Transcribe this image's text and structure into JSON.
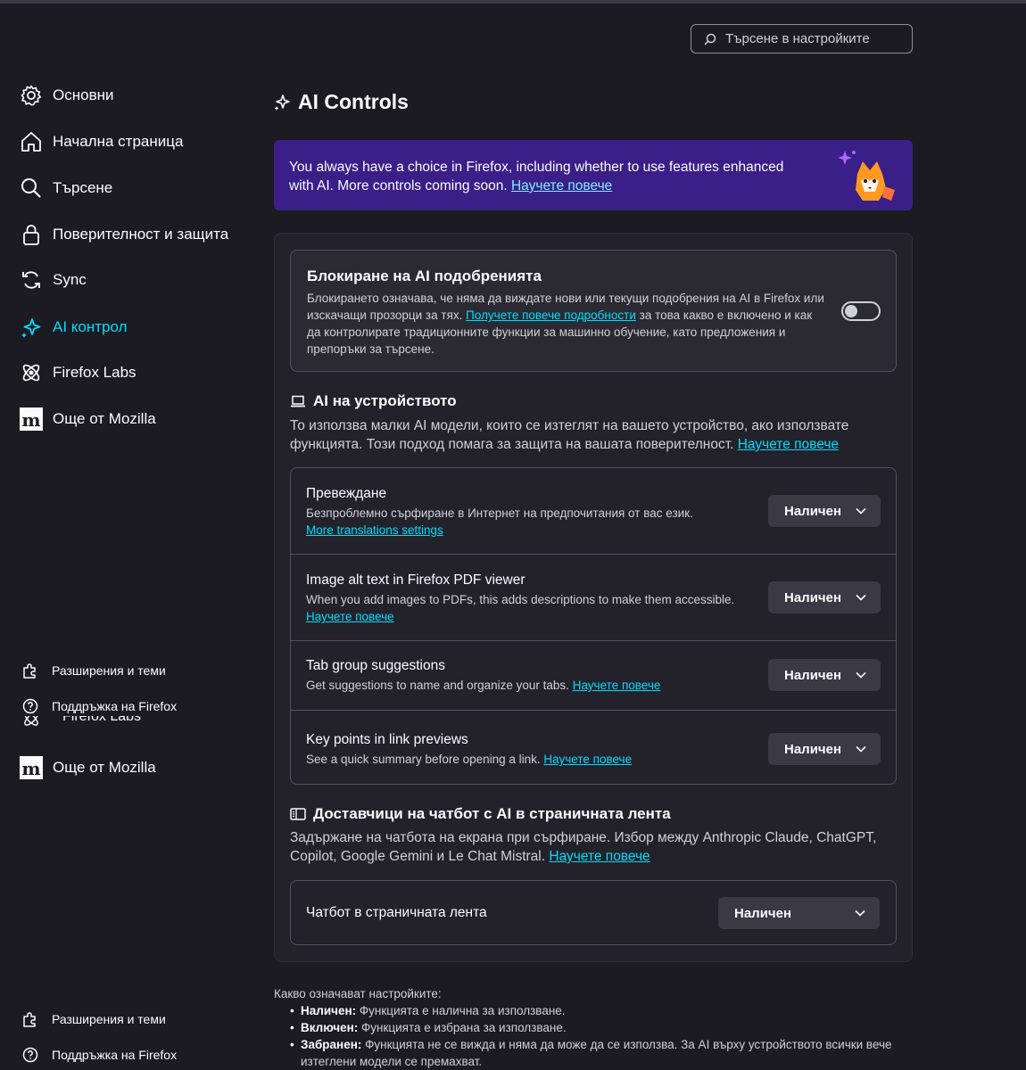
{
  "search": {
    "placeholder": "Търсене в настройките"
  },
  "sidebar": {
    "items": [
      {
        "label": "Основни",
        "icon": "gear-icon"
      },
      {
        "label": "Начална страница",
        "icon": "home-icon"
      },
      {
        "label": "Търсене",
        "icon": "search-icon"
      },
      {
        "label": "Поверителност и защита",
        "icon": "lock-icon"
      },
      {
        "label": "Sync",
        "icon": "sync-icon"
      },
      {
        "label": "AI контрол",
        "icon": "sparkle-icon",
        "active": true
      },
      {
        "label": "Firefox Labs",
        "icon": "labs-icon"
      },
      {
        "label": "Още от Mozilla",
        "icon": "mozilla-icon"
      }
    ],
    "footer_first": [
      {
        "label": "Разширения и теми",
        "icon": "puzzle-icon"
      },
      {
        "label": "Поддръжка на Firefox",
        "icon": "help-icon"
      }
    ],
    "ghost_labs": "Firefox Labs",
    "ghost_mozilla": "Още от Mozilla",
    "footer_second": [
      {
        "label": "Разширения и теми",
        "icon": "puzzle-icon"
      },
      {
        "label": "Поддръжка на Firefox",
        "icon": "help-icon"
      }
    ]
  },
  "main": {
    "title": "AI Controls",
    "banner": {
      "text": "You always have a choice in Firefox, including whether to use features enhanced with AI. More controls coming soon.",
      "link": "Научете повече"
    },
    "block": {
      "title": "Блокиране на AI подобренията",
      "desc_before": "Блокирането означава, че няма да виждате нови или текущи подобрения на AI в Firefox или изскачащи прозорци за тях.",
      "link": "Получете повече подробности",
      "desc_after": "за това какво е включено и как да контролирате традиционните функции за машинно обучение, като предложения и препоръки за търсене.",
      "toggle_on": false
    },
    "on_device": {
      "title": "AI на устройството",
      "desc": "То използва малки AI модели, които се изтеглят на вашето устройство, ако използвате функцията. Този подход помага за защита на вашата поверителност.",
      "link": "Научете повече",
      "rows": [
        {
          "title": "Превеждане",
          "desc": "Безпроблемно сърфиране в Интернет на предпочитания от вас език.",
          "link": "More translations settings",
          "value": "Наличен"
        },
        {
          "title": "Image alt text in Firefox PDF viewer",
          "desc": "When you add images to PDFs, this adds descriptions to make them accessible.",
          "link": "Научете повече",
          "value": "Наличен"
        },
        {
          "title": "Tab group suggestions",
          "desc": "Get suggestions to name and organize your tabs.",
          "link": "Научете повече",
          "value": "Наличен"
        },
        {
          "title": "Key points in link previews",
          "desc": "See a quick summary before opening a link.",
          "link": "Научете повече",
          "value": "Наличен"
        }
      ]
    },
    "chatbot": {
      "title": "Доставчици на чатбот с AI в страничната лента",
      "desc": "Задържане на чатбота на екрана при сърфиране. Избор между Anthropic Claude, ChatGPT, Copilot, Google Gemini и Le Chat Mistral.",
      "link": "Научете повече",
      "row_label": "Чатбот в страничната лента",
      "value": "Наличен"
    },
    "legend": {
      "intro": "Какво означават настройките:",
      "items": [
        {
          "term": "Наличен:",
          "text": "Функцията е налична за използване."
        },
        {
          "term": "Включен:",
          "text": "Функцията е избрана за използване."
        },
        {
          "term": "Забранен:",
          "text": "Функцията не се вижда и няма да може да се използва. За AI върху устройството всички вече изтеглени модели се премахват."
        }
      ]
    }
  },
  "colors": {
    "accent": "#00ddff",
    "banner": "#3b1f88",
    "background": "#1c1b22"
  }
}
